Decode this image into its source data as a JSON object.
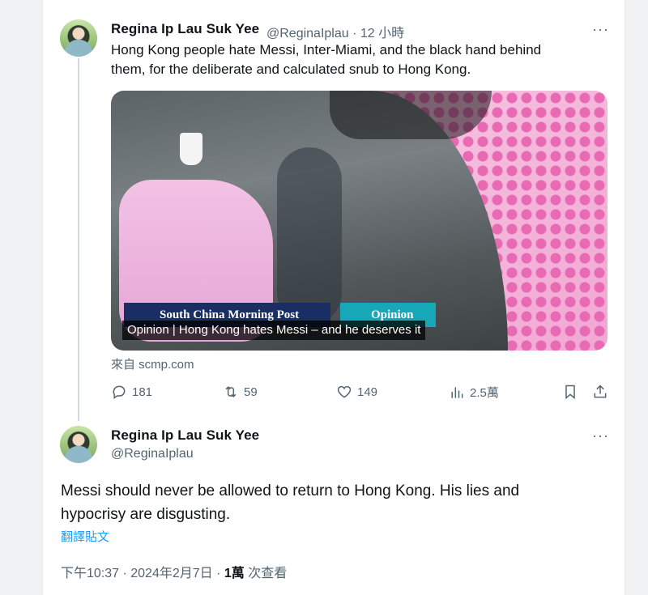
{
  "tweet1": {
    "name": "Regina Ip Lau Suk Yee",
    "handle": "@ReginaIplau",
    "time": "· 12 小時",
    "more": "···",
    "text_line1": "Hong Kong people hate Messi, Inter-Miami, and the black hand behind",
    "text_line2": "them, for the deliberate and calculated snub to Hong Kong.",
    "media": {
      "banner_left": "South China Morning Post",
      "banner_right": "Opinion",
      "caption": "Opinion | Hong Kong hates Messi – and he deserves it"
    },
    "source": "來自 scmp.com",
    "actions": {
      "replies": "181",
      "reposts": "59",
      "likes": "149",
      "views": "2.5萬"
    }
  },
  "tweet2": {
    "name": "Regina Ip Lau Suk Yee",
    "handle": "@ReginaIplau",
    "more": "···",
    "text_line1": "Messi should never be allowed to return to Hong Kong. His lies and",
    "text_line2": "hypocrisy are disgusting.",
    "translate": "翻譯貼文",
    "timestamp": "下午10:37 · 2024年2月7日 · ",
    "views_count": "1萬",
    "views_label": " 次查看"
  }
}
